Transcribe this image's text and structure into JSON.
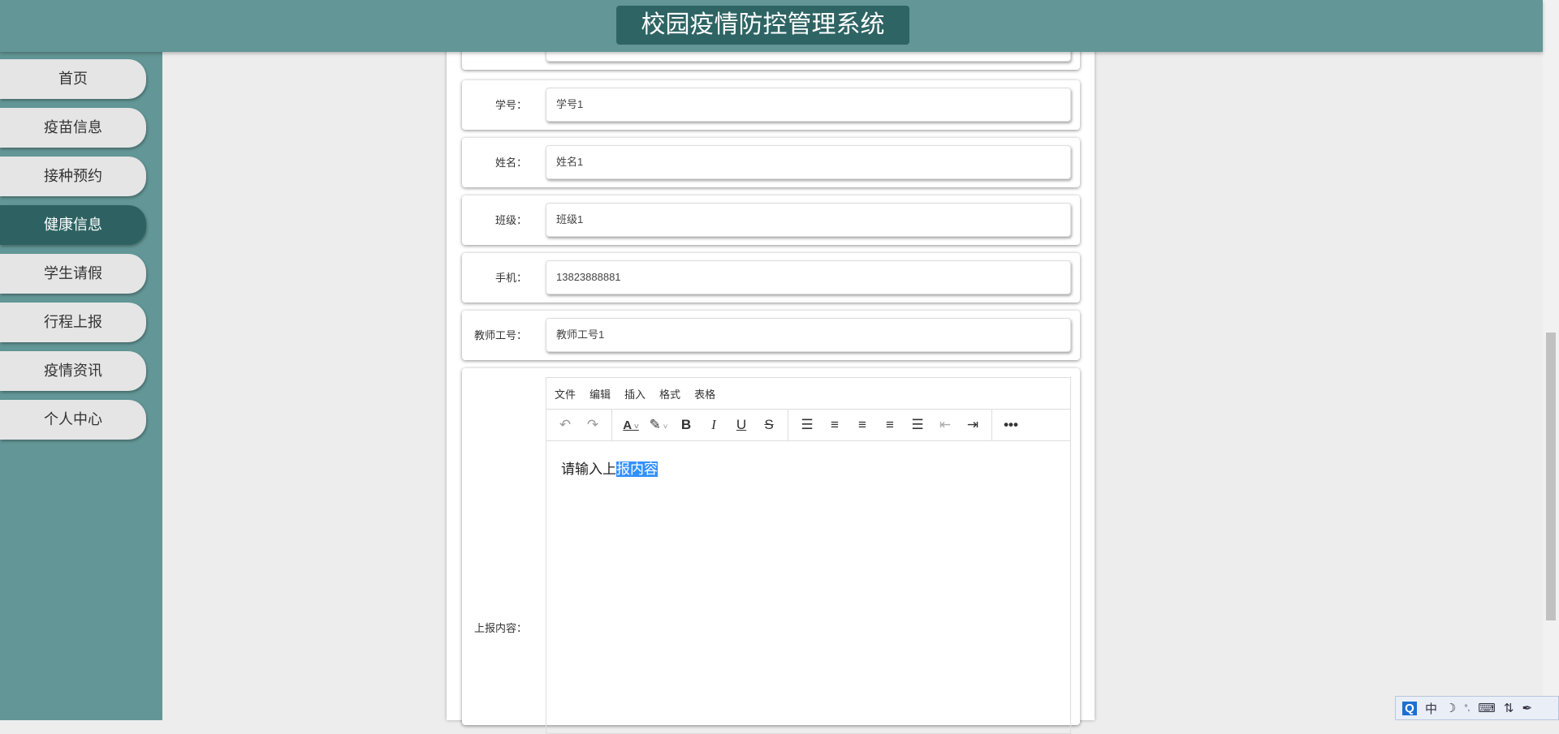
{
  "header": {
    "title": "校园疫情防控管理系统"
  },
  "sidebar": {
    "items": [
      {
        "label": "首页"
      },
      {
        "label": "疫苗信息"
      },
      {
        "label": "接种预约"
      },
      {
        "label": "健康信息",
        "active": true
      },
      {
        "label": "学生请假"
      },
      {
        "label": "行程上报"
      },
      {
        "label": "疫情资讯"
      },
      {
        "label": "个人中心"
      }
    ]
  },
  "form": {
    "fields": [
      {
        "label": "学号：",
        "value": "学号1"
      },
      {
        "label": "姓名：",
        "value": "姓名1"
      },
      {
        "label": "班级：",
        "value": "班级1"
      },
      {
        "label": "手机：",
        "value": "13823888881"
      },
      {
        "label": "教师工号：",
        "value": "教师工号1"
      }
    ],
    "editor": {
      "label": "上报内容：",
      "menu": [
        "文件",
        "编辑",
        "插入",
        "格式",
        "表格"
      ],
      "content_plain": "请输入上",
      "content_selected": "报内容"
    }
  },
  "tray": {
    "items": [
      "中"
    ]
  }
}
